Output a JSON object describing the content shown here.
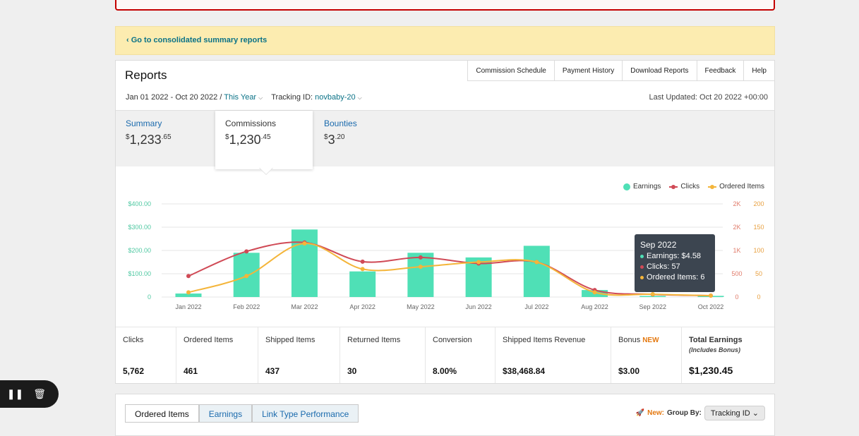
{
  "banner": {
    "link_text": "‹ Go to consolidated summary reports"
  },
  "reports": {
    "title": "Reports",
    "top_tabs": [
      "Commission Schedule",
      "Payment History",
      "Download Reports",
      "Feedback",
      "Help"
    ],
    "date_range": "Jan 01 2022 - Oct 20 2022 /",
    "period": "This Year",
    "tracking_label": "Tracking ID:",
    "tracking_id": "novbaby-20",
    "last_updated": "Last Updated: Oct 20 2022 +00:00"
  },
  "summary_tabs": [
    {
      "label": "Summary",
      "currency": "$",
      "whole": "1,233",
      "cents": ".65"
    },
    {
      "label": "Commissions",
      "currency": "$",
      "whole": "1,230",
      "cents": ".45"
    },
    {
      "label": "Bounties",
      "currency": "$",
      "whole": "3",
      "cents": ".20"
    }
  ],
  "legend": {
    "earnings": "Earnings",
    "clicks": "Clicks",
    "ordered": "Ordered Items"
  },
  "colors": {
    "earnings": "#4fe0b6",
    "clicks": "#d04a56",
    "ordered": "#f4b53a",
    "link": "#0a7287",
    "accent": "#e47911"
  },
  "tooltip": {
    "title": "Sep 2022",
    "earnings": "Earnings: $4.58",
    "clicks": "Clicks: 57",
    "ordered": "Ordered Items: 6"
  },
  "chart_data": {
    "type": "bar",
    "categories": [
      "Jan 2022",
      "Feb 2022",
      "Mar 2022",
      "Apr 2022",
      "May 2022",
      "Jun 2022",
      "Jul 2022",
      "Aug 2022",
      "Sep 2022",
      "Oct 2022"
    ],
    "series": [
      {
        "name": "Earnings",
        "type": "bar",
        "axis": "left",
        "values": [
          15,
          190,
          290,
          110,
          190,
          170,
          220,
          30,
          4.58,
          5
        ]
      },
      {
        "name": "Clicks",
        "type": "line",
        "axis": "right1",
        "values": [
          450,
          980,
          1170,
          760,
          850,
          720,
          750,
          150,
          57,
          30
        ]
      },
      {
        "name": "Ordered Items",
        "type": "line",
        "axis": "right2",
        "values": [
          10,
          45,
          115,
          60,
          65,
          75,
          75,
          10,
          6,
          3
        ]
      }
    ],
    "left_axis": {
      "ticks": [
        "0",
        "$100.00",
        "$200.00",
        "$300.00",
        "$400.00"
      ],
      "max": 400
    },
    "right1_axis": {
      "ticks": [
        "0",
        "500",
        "1K",
        "2K",
        "2K"
      ],
      "max": 2000
    },
    "right2_axis": {
      "ticks": [
        "0",
        "50",
        "100",
        "150",
        "200"
      ],
      "max": 200
    },
    "grid": true,
    "legend": "top-right"
  },
  "stats": [
    {
      "label": "Clicks",
      "value": "5,762"
    },
    {
      "label": "Ordered Items",
      "value": "461"
    },
    {
      "label": "Shipped Items",
      "value": "437"
    },
    {
      "label": "Returned Items",
      "value": "30"
    },
    {
      "label": "Conversion",
      "value": "8.00%"
    },
    {
      "label": "Shipped Items Revenue",
      "value": "$38,468.84"
    },
    {
      "label": "Bonus",
      "badge": "NEW",
      "value": "$3.00"
    },
    {
      "label": "Total Earnings",
      "sub": "(Includes Bonus)",
      "value": "$1,230.45"
    }
  ],
  "bottom": {
    "tabs": [
      "Ordered Items",
      "Earnings",
      "Link Type Performance"
    ],
    "new_label": "New:",
    "group_by_label": "Group By:",
    "group_by_value": "Tracking ID"
  }
}
